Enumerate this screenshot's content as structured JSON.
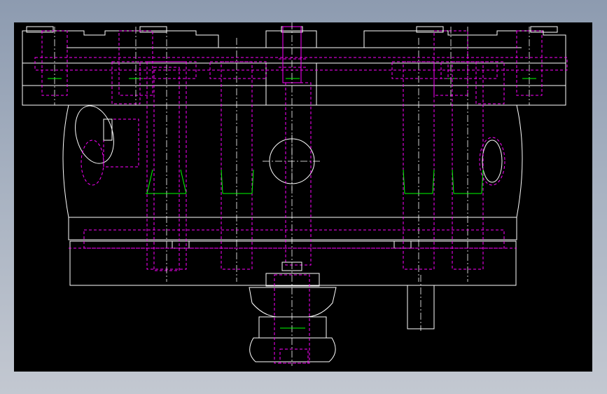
{
  "canvas": {
    "background_color": "#000000",
    "window_background": "#a3aebf"
  },
  "line_colors": {
    "visible_edges": "#ffffff",
    "hidden_edges": "#ff00ff",
    "highlight_edges": "#00ff00"
  },
  "drawing": {
    "view": "front elevation",
    "linetypes": [
      "solid",
      "dashed",
      "center"
    ]
  }
}
